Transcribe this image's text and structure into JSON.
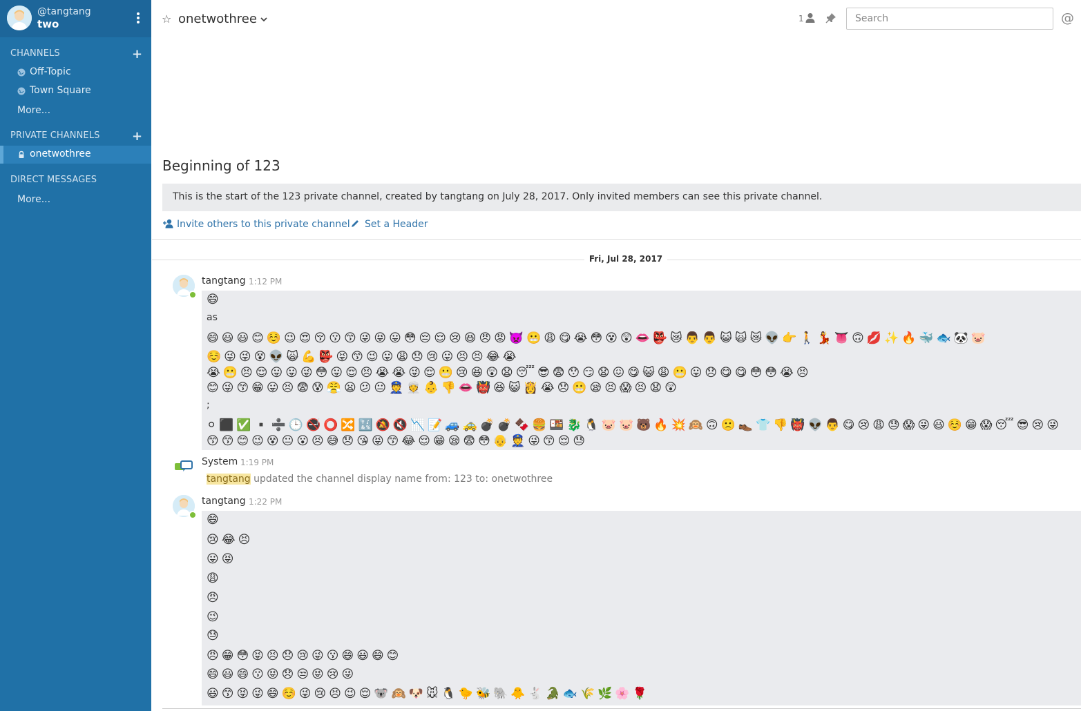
{
  "sidebar": {
    "username": "@tangtang",
    "team_name": "two",
    "channels_header": "CHANNELS",
    "channels": [
      {
        "label": "Off-Topic"
      },
      {
        "label": "Town Square"
      }
    ],
    "channels_more": "More...",
    "private_header": "PRIVATE CHANNELS",
    "private_channels": [
      {
        "label": "onetwothree",
        "active": true
      }
    ],
    "dm_header": "DIRECT MESSAGES",
    "dm_more": "More...",
    "colors": {
      "bg": "#2071a7",
      "header_bg": "#1d669a",
      "active_bg": "#2c80b9"
    }
  },
  "header": {
    "channel_name": "onetwothree",
    "member_count": "1",
    "search_placeholder": "Search",
    "at_symbol": "@"
  },
  "intro": {
    "title": "Beginning of 123",
    "description": "This is the start of the 123 private channel, created by tangtang on July 28, 2017. Only invited members can see this private channel.",
    "invite_link": "Invite others to this private channel",
    "header_link": "Set a Header"
  },
  "date_separator": "Fri, Jul 28, 2017",
  "posts": [
    {
      "user": "tangtang",
      "time": "1:12 PM",
      "text_lines": [
        "as",
        ";"
      ],
      "emoji_rows": [
        "😄",
        "😄😃😃😊☺️😉😍😚😗😙😜😝😛😳😔😌😢😆😠😡👿😬😩😋😭😳😵😲👄👺😿👨👨😺🙀😿👽👉🚶💃👅🙃💋✨🔥🐳🐟🐼🐷",
        "☺️😜😜😵👽🙀💪👺😝😙😉😛😩😞😢😛😣😣😂😭",
        "😭😬😣😌😛😛😜😳😛😌😣😭😭😜😌😬😢😆😲😧😴😎😨😯😏😧😖😋😺😩😬😛😞😋😋😳😳😭😣",
        "😊😜😙😁😛😣😨😰😤😦😕😐👮👳👶👎👄👹😆😺👸😭😞😬😪😣😱😣😧😲",
        "⚪⬛✅▪️➗🕒🚭⭕🔀🔣🔕🔇📉📝🚙🚕💣💣🍫🍔🍱🐉🐧🐷🐷🐻🔥💥🙉🙃🙁👞👕👎👹👽👨😋😢😩😓😱😜😃☺️😁😱😴😎😢😜",
        "😙😙😊😉😵😐😮😣😅😞😘😝😙😂😌😁😪😨😳👴👮😜😙😌😓"
      ]
    },
    {
      "user": "System",
      "time": "1:19 PM",
      "mention": "tangtang",
      "text": " updated the channel display name from: 123 to: onetwothree"
    },
    {
      "user": "tangtang",
      "time": "1:22 PM",
      "emoji_rows": [
        "😄",
        "😢😂😣",
        "😛😝",
        "😩",
        "😠",
        "😉",
        "😓",
        "😠😁😳😝😣😞😢😜😗😄😃😄😊",
        "😄😃😄😗😝😞😒😝😢😜",
        "😃😙😝😜😄☺️😜😢😣😉😌🐨🙉🐶🐭🐧🐤🐝🐘🐥🐇🐊🐟🌾🌿🌸🌹"
      ]
    }
  ]
}
